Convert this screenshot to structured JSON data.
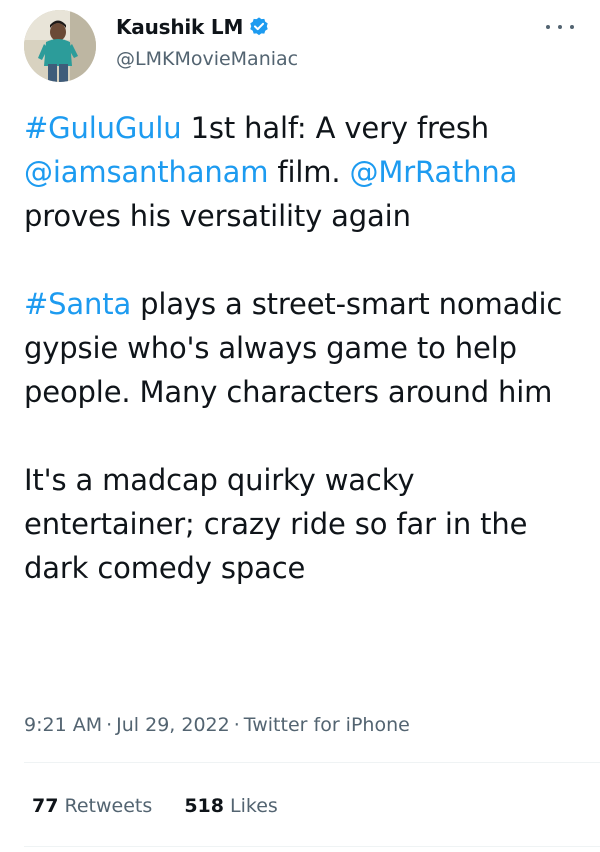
{
  "author": {
    "display_name": "Kaushik LM",
    "handle": "@LMKMovieManiac",
    "verified": true
  },
  "menu_icon": "more-horizontal-icon",
  "tweet": {
    "paragraphs": [
      [
        {
          "text": "#GuluGulu",
          "link": true
        },
        {
          "text": " 1st half: A very fresh ",
          "link": false
        },
        {
          "text": "@iamsanthanam",
          "link": true
        },
        {
          "text": " film. ",
          "link": false
        },
        {
          "text": "@MrRathna",
          "link": true
        },
        {
          "text": " proves his versatility again",
          "link": false
        }
      ],
      [
        {
          "text": "#Santa",
          "link": true
        },
        {
          "text": " plays a street-smart nomadic gypsie who's always game to help people. Many characters around him",
          "link": false
        }
      ],
      [
        {
          "text": "It's a madcap quirky wacky entertainer; crazy ride so far in the dark comedy space",
          "link": false
        }
      ]
    ]
  },
  "meta": {
    "time": "9:21 AM",
    "separator": "·",
    "date": "Jul 29, 2022",
    "source": "Twitter for iPhone"
  },
  "stats": {
    "retweets_count": "77",
    "retweets_label": "Retweets",
    "likes_count": "518",
    "likes_label": "Likes"
  },
  "colors": {
    "link": "#1d9bf0",
    "text": "#0f1419",
    "secondary": "#536471",
    "verified": "#1d9bf0"
  }
}
